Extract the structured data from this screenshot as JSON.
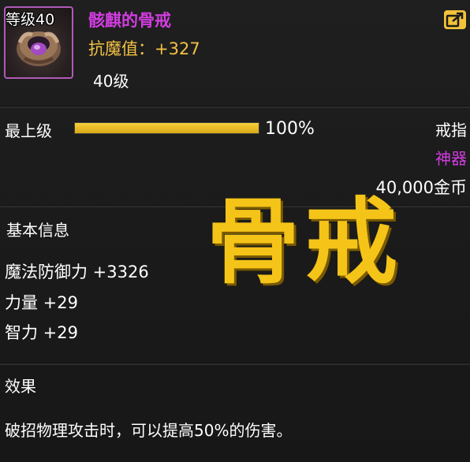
{
  "item": {
    "level_tag": "等级40",
    "name": "骸麒的骨戒",
    "stat": "抗魔值：+327",
    "level": "40级"
  },
  "grade": {
    "label": "最上级",
    "progress_fraction": 1.0,
    "percent_text": "100%"
  },
  "meta": {
    "type": "戒指",
    "rarity": "神器",
    "price": "40,000金币"
  },
  "basic_info": {
    "title": "基本信息",
    "attributes": [
      "魔法防御力 +3326",
      "力量 +29",
      "智力 +29"
    ]
  },
  "overlay": {
    "title": "骨戒"
  },
  "effect": {
    "title": "效果",
    "text": "破招物理攻击时，可以提高50%的伤害。"
  },
  "icons": {
    "share": "share-icon",
    "item": "bone-ring-icon"
  },
  "colors": {
    "epic_purple": "#d23de0",
    "gold": "#f3c244",
    "overlay_yellow": "#f5c418"
  }
}
